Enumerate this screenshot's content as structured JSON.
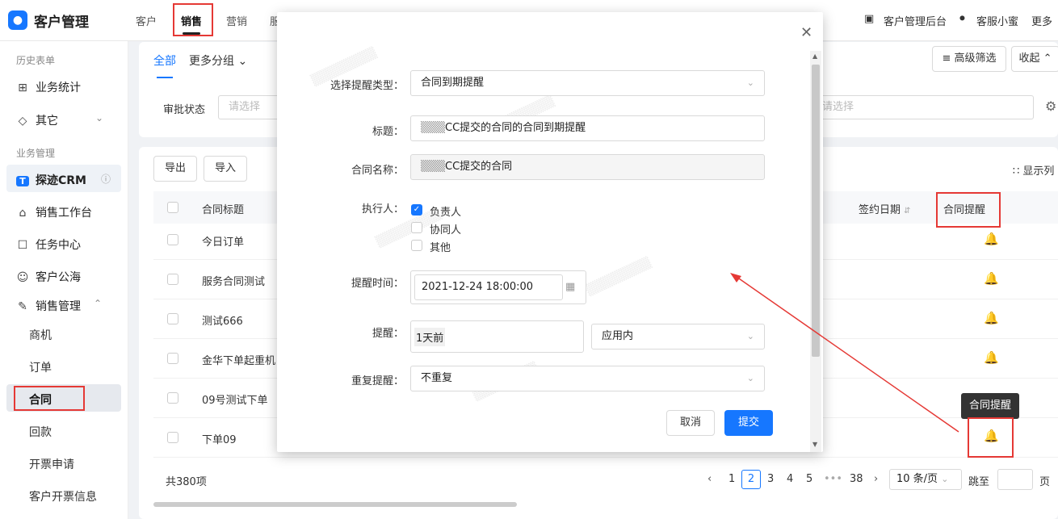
{
  "app": {
    "title": "客户管理",
    "logo_icon": "person-icon"
  },
  "topnav": {
    "items": [
      "客户",
      "销售",
      "营销",
      "服"
    ],
    "active": "销售"
  },
  "topright": {
    "admin": "客户管理后台",
    "service": "客服小蜜",
    "more": "更多"
  },
  "sidebar": {
    "history_group": "历史表单",
    "history_items": [
      {
        "label": "业务统计"
      },
      {
        "label": "其它"
      }
    ],
    "biz_group": "业务管理",
    "crm_label": "探迹CRM",
    "items": [
      {
        "label": "销售工作台"
      },
      {
        "label": "任务中心"
      },
      {
        "label": "客户公海"
      },
      {
        "label": "销售管理"
      }
    ],
    "sub_items": [
      "商机",
      "订单",
      "合同",
      "回款",
      "开票申请",
      "客户开票信息"
    ],
    "active_sub": "合同"
  },
  "filter": {
    "tab_all": "全部",
    "tab_more": "更多分组",
    "advanced": "高级筛选",
    "collapse": "收起",
    "approval_label": "审批状态",
    "approval_placeholder": "请选择",
    "right_placeholder": "请选择"
  },
  "toolbar": {
    "export": "导出",
    "import": "导入",
    "display_cols": "显示列"
  },
  "table": {
    "columns": {
      "title": "合同标题",
      "sign_date": "签约日期",
      "reminder": "合同提醒"
    },
    "rows": [
      {
        "title": "今日订单"
      },
      {
        "title": "服务合同测试"
      },
      {
        "title": "测试666"
      },
      {
        "title": "金华下单起重机"
      },
      {
        "title": "09号测试下单"
      },
      {
        "title": "下单09"
      }
    ]
  },
  "pagination": {
    "total": "共380项",
    "pages": [
      "1",
      "2",
      "3",
      "4",
      "5",
      "•••",
      "38"
    ],
    "current": "2",
    "page_size": "10 条/页",
    "jump": "跳至",
    "page_unit": "页"
  },
  "tooltip": {
    "text": "合同提醒"
  },
  "modal": {
    "fields": {
      "type_label": "选择提醒类型：",
      "type_value": "合同到期提醒",
      "title_label": "标题：",
      "title_value": "CC提交的合同的合同到期提醒",
      "contract_label": "合同名称：",
      "contract_value": "CC提交的合同",
      "executor_label": "执行人：",
      "executors": [
        {
          "label": "负责人",
          "checked": true
        },
        {
          "label": "协同人",
          "checked": false
        },
        {
          "label": "其他",
          "checked": false
        }
      ],
      "time_label": "提醒时间：",
      "time_value": "2021-12-24 18:00:00",
      "remind_label": "提醒：",
      "remind_value": "1天前",
      "channel_value": "应用内",
      "repeat_label": "重复提醒：",
      "repeat_value": "不重复"
    },
    "cancel": "取消",
    "submit": "提交"
  },
  "colors": {
    "accent": "#1677ff",
    "annotation": "#e53935"
  }
}
